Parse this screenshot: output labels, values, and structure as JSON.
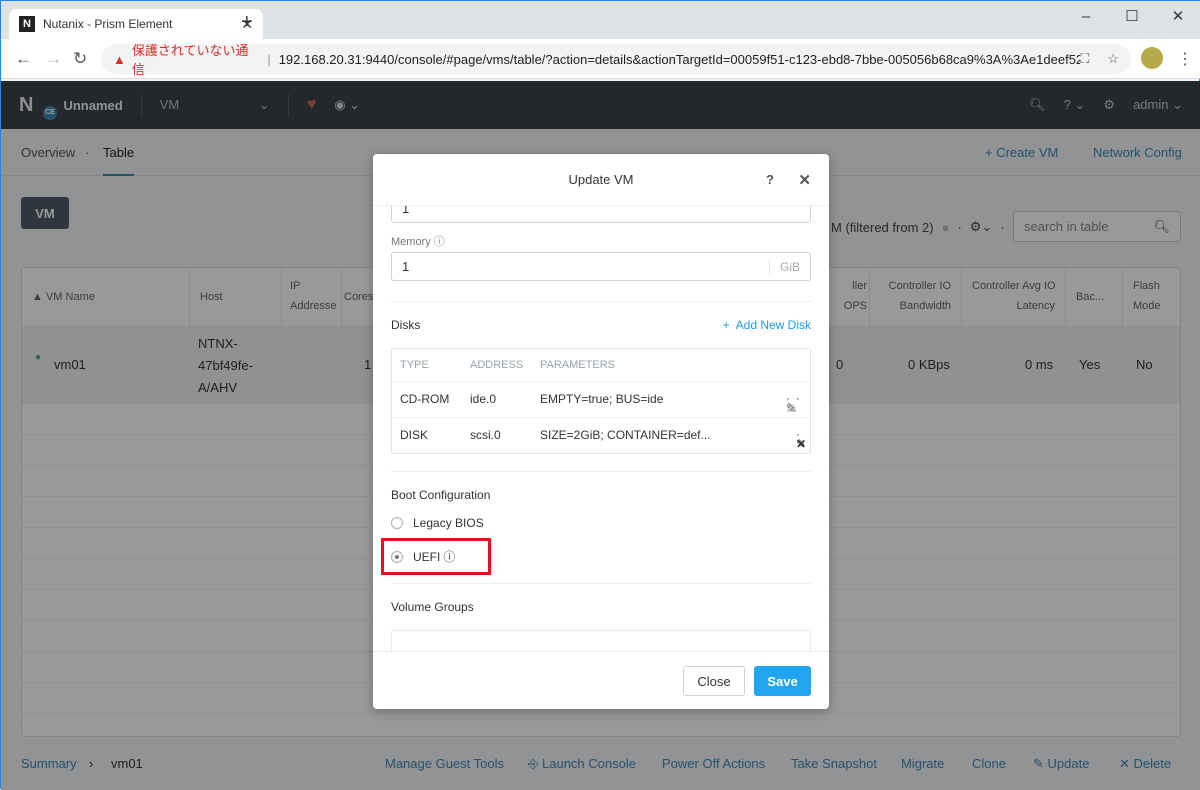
{
  "browser": {
    "tab_title": "Nutanix - Prism Element",
    "favicon": "N",
    "security_warning": "保護されていない通信",
    "url": "192.168.20.31:9440/console/#page/vms/table/?action=details&actionTargetId=00059f51-c123-ebd8-7bbe-005056b68ca9%3A%3Ae1deef52..."
  },
  "nav": {
    "logo": "N",
    "logo_badge": "CE",
    "cluster": "Unnamed",
    "section": "VM",
    "user": "admin"
  },
  "subnav": {
    "tabs": [
      "Overview",
      "Table"
    ],
    "active": "Table",
    "create_vm": "+ Create VM",
    "network_config": "Network Config"
  },
  "toolbar": {
    "vm_button": "VM",
    "filter_text": "M (filtered from 2)",
    "search_placeholder": "search in table"
  },
  "table": {
    "headers": [
      "VM Name",
      "Host",
      "IP Addresses",
      "Cores",
      "Controller IOPS",
      "Controller IO Bandwidth",
      "Controller Avg IO Latency",
      "Bac...",
      "Flash Mode"
    ],
    "header_visible": {
      "ip": [
        "IP",
        "Addresse"
      ],
      "cores": "Cores",
      "iops": [
        "ller",
        "OPS"
      ],
      "bw": [
        "Controller IO",
        "Bandwidth"
      ],
      "lat": [
        "Controller Avg IO",
        "Latency"
      ],
      "flash": [
        "Flash",
        "Mode"
      ]
    },
    "row": {
      "name": "vm01",
      "host": [
        "NTNX-",
        "47bf49fe-",
        "A/AHV"
      ],
      "cores": "1",
      "iops": "0",
      "bandwidth": "0 KBps",
      "latency": "0 ms",
      "backup": "Yes",
      "flash": "No",
      "status_color": "#2fb35a"
    }
  },
  "bottom": {
    "breadcrumb_root": "Summary",
    "breadcrumb_current": "vm01",
    "actions": [
      "Manage Guest Tools",
      "Launch Console",
      "Power Off Actions",
      "Take Snapshot",
      "Migrate",
      "Clone",
      "Update",
      "Delete"
    ]
  },
  "modal": {
    "title": "Update VM",
    "help": "?",
    "top_field_value": "1",
    "memory_label": "Memory",
    "memory_value": "1",
    "memory_unit": "GiB",
    "disks_title": "Disks",
    "add_disk": "Add New Disk",
    "disk_headers": [
      "TYPE",
      "ADDRESS",
      "PARAMETERS"
    ],
    "disks": [
      {
        "type": "CD-ROM",
        "address": "ide.0",
        "params": "EMPTY=true; BUS=ide"
      },
      {
        "type": "DISK",
        "address": "scsi.0",
        "params": "SIZE=2GiB; CONTAINER=def..."
      }
    ],
    "boot_title": "Boot Configuration",
    "boot_options": [
      "Legacy BIOS",
      "UEFI"
    ],
    "boot_selected": "UEFI",
    "volume_groups_title": "Volume Groups",
    "close": "Close",
    "save": "Save"
  },
  "colors": {
    "accent": "#22a5f1",
    "highlight": "#e5111e",
    "nav_bg": "#22272e"
  }
}
